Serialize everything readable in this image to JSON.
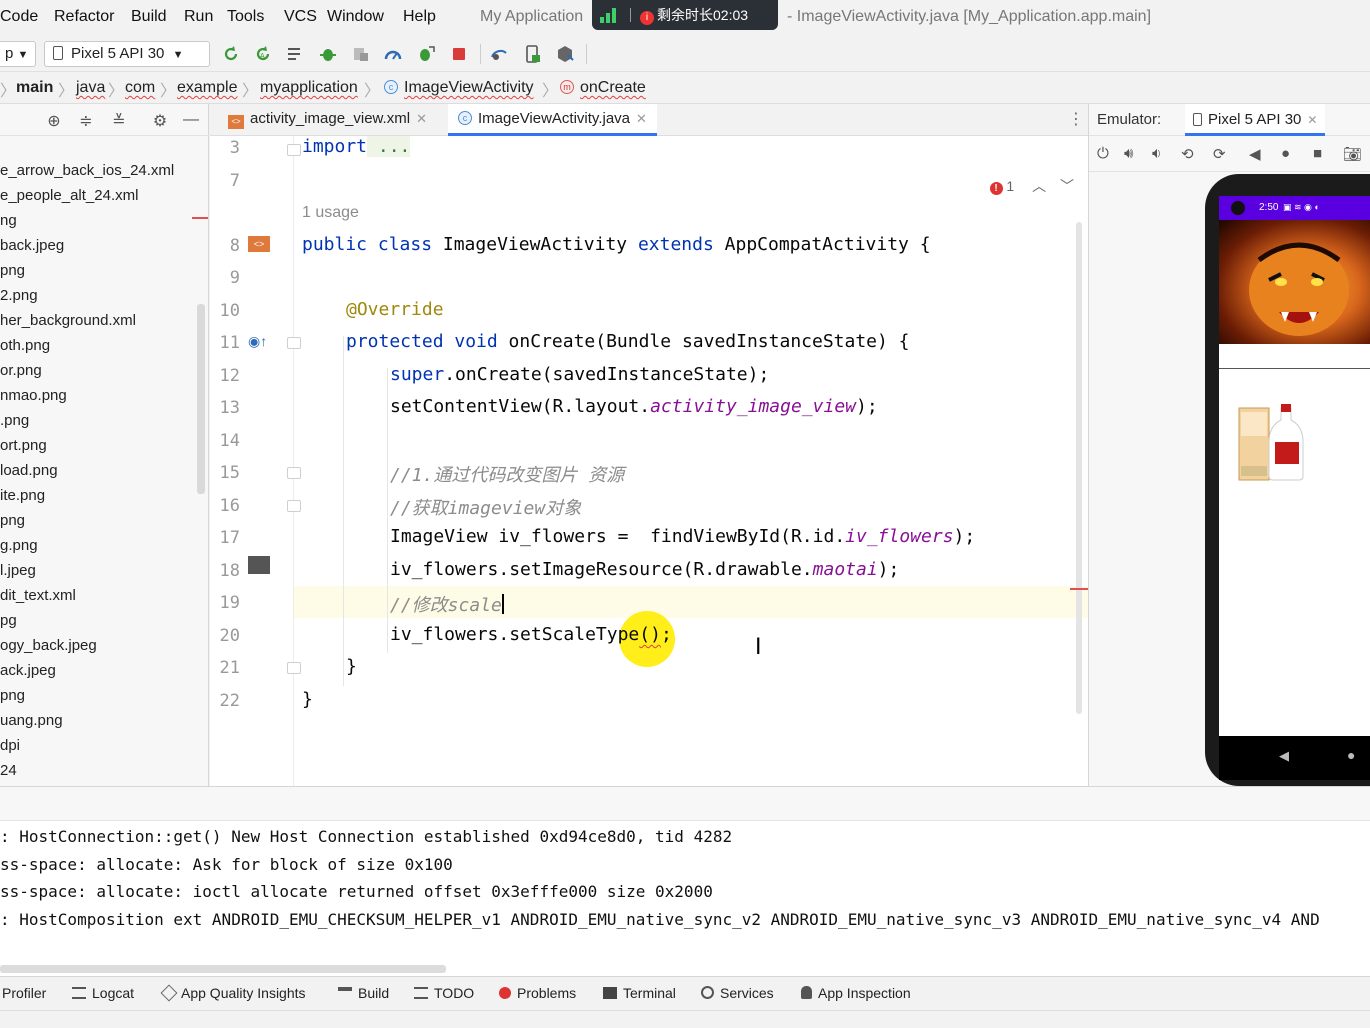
{
  "menu": {
    "items": [
      "Code",
      "Refactor",
      "Build",
      "Run",
      "Tools",
      "VCS",
      "Window",
      "Help"
    ],
    "title_left": "My Application",
    "title_right": "- ImageViewActivity.java [My_Application.app.main]"
  },
  "overlay": {
    "timer_label": "剩余时长02:03",
    "dot": "i"
  },
  "toolbar": {
    "config_combo": "p",
    "device_combo": "Pixel 5 API 30"
  },
  "breadcrumb": [
    "main",
    "java",
    "com",
    "example",
    "myapplication",
    "ImageViewActivity",
    "onCreate"
  ],
  "project": {
    "files": [
      "e_arrow_back_ios_24.xml",
      "e_people_alt_24.xml",
      "ng",
      "back.jpeg",
      "png",
      "2.png",
      "her_background.xml",
      "oth.png",
      "or.png",
      "nmao.png",
      ".png",
      "ort.png",
      "load.png",
      "ite.png",
      "png",
      "g.png",
      "l.jpeg",
      "dit_text.xml",
      "pg",
      "ogy_back.jpeg",
      "ack.jpeg",
      "png",
      "uang.png",
      "dpi",
      "24"
    ]
  },
  "editor": {
    "tabs": [
      {
        "label": "activity_image_view.xml",
        "active": false
      },
      {
        "label": "ImageViewActivity.java",
        "active": true
      }
    ],
    "inspection_count": "1",
    "usage_hint": "1 usage",
    "line_numbers": [
      "3",
      "7",
      "8",
      "9",
      "10",
      "11",
      "12",
      "13",
      "14",
      "15",
      "16",
      "17",
      "18",
      "19",
      "20",
      "21",
      "22"
    ],
    "code": {
      "l3_kw": "import",
      "l3_rest": " ...",
      "l8_a": "public class",
      "l8_b": " ImageViewActivity ",
      "l8_c": "extends",
      "l8_d": " AppCompatActivity {",
      "l10": "@Override",
      "l11_a": "protected void",
      "l11_b": " onCreate(Bundle savedInstanceState) {",
      "l12_a": "super",
      "l12_b": ".onCreate(savedInstanceState);",
      "l13_a": "setContentView(R.layout.",
      "l13_b": "activity_image_view",
      "l13_c": ");",
      "l15": "//1.通过代码改变图片 资源",
      "l16": "//获取imageview对象",
      "l17_a": "ImageView iv_flowers =  findViewById(R.id.",
      "l17_b": "iv_flowers",
      "l17_c": ");",
      "l18_a": "iv_flowers.setImageResource(R.drawable.",
      "l18_b": "maotai",
      "l18_c": ");",
      "l19": "//修改scale",
      "l20_a": "iv_flowers.setScaleType",
      "l20_b": "()",
      "l20_c": ";",
      "l21": "}",
      "l22": "}"
    }
  },
  "emulator": {
    "label": "Emulator:",
    "device_tab": "Pixel 5 API 30",
    "clock": "2:50"
  },
  "log": {
    "lines": [
      ": HostConnection::get() New Host Connection established 0xd94ce8d0, tid 4282",
      "ss-space: allocate: Ask for block of size 0x100",
      "ss-space: allocate: ioctl allocate returned offset 0x3efffe000 size 0x2000",
      ": HostComposition ext ANDROID_EMU_CHECKSUM_HELPER_v1 ANDROID_EMU_native_sync_v2 ANDROID_EMU_native_sync_v3 ANDROID_EMU_native_sync_v4 AND"
    ]
  },
  "tool_tabs": [
    "Profiler",
    "Logcat",
    "App Quality Insights",
    "Build",
    "TODO",
    "Problems",
    "Terminal",
    "Services",
    "App Inspection"
  ],
  "colors": {
    "keyword": "#0033b3",
    "annotation": "#9e880d",
    "comment": "#8c8c8c",
    "field": "#871094",
    "accent": "#3574f0"
  }
}
